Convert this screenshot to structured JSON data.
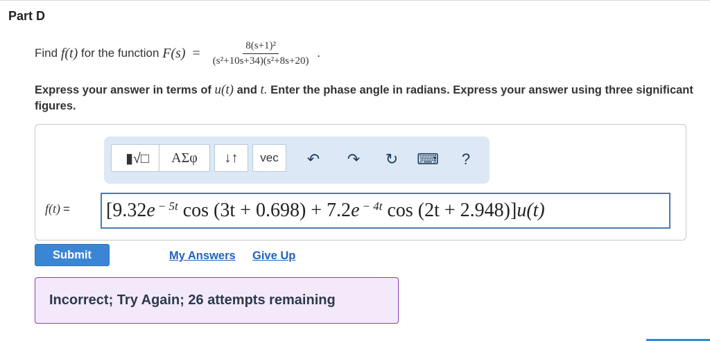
{
  "part": {
    "title": "Part D"
  },
  "question": {
    "lead": "Find",
    "ft": "f(t)",
    "for_function": "for the function",
    "Fs": "F(s)",
    "equals": "=",
    "numerator": "8(s+1)²",
    "denominator": "(s²+10s+34)(s²+8s+20)",
    "end": "."
  },
  "instructions": {
    "part1": "Express your answer in terms of",
    "u": "u(t)",
    "and": "and",
    "t": "t.",
    "part2": "Enter the phase angle in radians. Express your answer using three significant figures."
  },
  "toolbar": {
    "templates_glyph": "▮√□",
    "greek_label": "ΑΣφ",
    "updown_label": "↓↑",
    "vec_label": "vec",
    "undo_glyph": "↶",
    "redo_glyph": "↷",
    "reset_glyph": "↻",
    "keyboard_glyph": "⌨",
    "help_label": "?"
  },
  "answer": {
    "label": "f(t)",
    "label_eq": "=",
    "open": "[9.32",
    "e1": "e",
    "exp1": "− 5t",
    "cos1": "cos",
    "arg1": "(3t + 0.698) + 7.2",
    "e2": "e",
    "exp2": "− 4t",
    "cos2": "cos",
    "arg2": "(2t + 2.948)]",
    "u": "u(t)"
  },
  "actions": {
    "submit": "Submit",
    "my_answers": "My Answers",
    "give_up": "Give Up"
  },
  "feedback": {
    "message": "Incorrect; Try Again; 26 attempts remaining"
  },
  "colors": {
    "submit_bg": "#3b86d4",
    "link": "#2164b6",
    "feedback_bg": "#f3e9fb",
    "feedback_border": "#8a3bbe",
    "toolbar_bg": "#dce8f6",
    "input_border": "#4a7ab0"
  }
}
